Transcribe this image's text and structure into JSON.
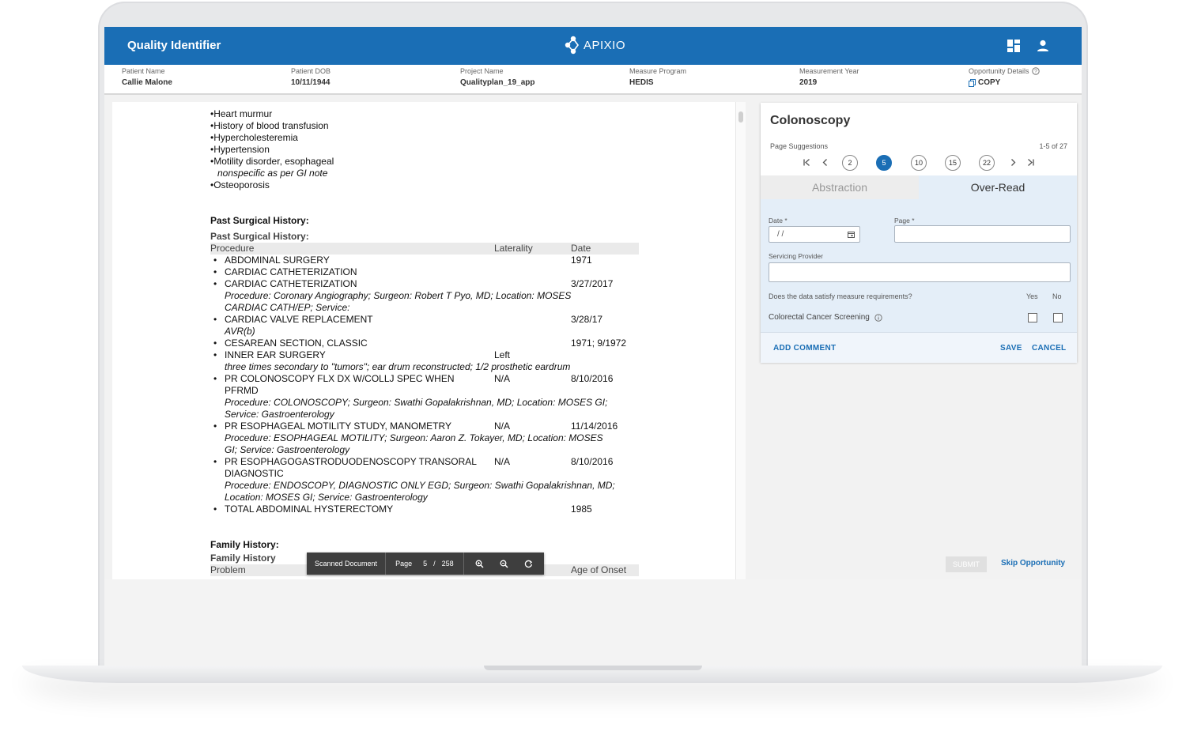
{
  "header": {
    "title": "Quality Identifier",
    "logo_text": "APIXIO"
  },
  "info": [
    {
      "label": "Patient Name",
      "value": "Callie Malone"
    },
    {
      "label": "Patient DOB",
      "value": "10/11/1944"
    },
    {
      "label": "Project Name",
      "value": "Qualityplan_19_app"
    },
    {
      "label": "Measure Program",
      "value": "HEDIS"
    },
    {
      "label": "Measurement Year",
      "value": "2019"
    },
    {
      "label": "Opportunity Details",
      "value": "COPY"
    }
  ],
  "document": {
    "conditions": [
      "Heart murmur",
      "History of blood transfusion",
      "Hypercholesteremia",
      "Hypertension",
      "Motility disorder, esophageal"
    ],
    "condition_note": "nonspecific as per GI note",
    "last_condition": "Osteoporosis",
    "surg_heading": "Past Surgical History:",
    "surg_sub": "Past Surgical History:",
    "table_headers": {
      "procedure": "Procedure",
      "laterality": "Laterality",
      "date": "Date"
    },
    "rows": [
      {
        "proc": "ABDOMINAL SURGERY",
        "lat": "",
        "date": "1971"
      },
      {
        "proc": "CARDIAC CATHETERIZATION",
        "lat": "",
        "date": ""
      },
      {
        "proc": "CARDIAC CATHETERIZATION",
        "lat": "",
        "date": "3/27/2017"
      },
      {
        "note": "Procedure: Coronary Angiography;  Surgeon: Robert T Pyo, MD;  Location: MOSES"
      },
      {
        "note": "CARDIAC CATH/EP;  Service:"
      },
      {
        "proc": "CARDIAC VALVE REPLACEMENT",
        "lat": "",
        "date": "3/28/17"
      },
      {
        "note": "AVR(b)"
      },
      {
        "proc": "CESAREAN SECTION, CLASSIC",
        "lat": "",
        "date": "1971; 9/1972"
      },
      {
        "proc": "INNER EAR SURGERY",
        "lat": "Left",
        "date": ""
      },
      {
        "note": "three times secondary to \"tumors\"; ear drum reconstructed; 1/2 prosthetic eardrum"
      },
      {
        "proc": "PR COLONOSCOPY FLX DX W/COLLJ SPEC WHEN",
        "lat": "N/A",
        "date": "8/10/2016"
      },
      {
        "cont": "PFRMD"
      },
      {
        "note": "Procedure: COLONOSCOPY;  Surgeon: Swathi Gopalakrishnan, MD;  Location: MOSES GI;"
      },
      {
        "note": "Service: Gastroenterology"
      },
      {
        "proc": "PR ESOPHAGEAL MOTILITY STUDY, MANOMETRY",
        "lat": "N/A",
        "date": "11/14/2016"
      },
      {
        "note": "Procedure: ESOPHAGEAL MOTILITY;  Surgeon: Aaron Z. Tokayer, MD;  Location: MOSES"
      },
      {
        "note": "GI;  Service: Gastroenterology"
      },
      {
        "proc": "PR ESOPHAGOGASTRODUODENOSCOPY TRANSORAL",
        "lat": "N/A",
        "date": "8/10/2016"
      },
      {
        "cont": "DIAGNOSTIC"
      },
      {
        "note": "Procedure: ENDOSCOPY, DIAGNOSTIC ONLY EGD;  Surgeon: Swathi Gopalakrishnan, MD;"
      },
      {
        "note": "Location: MOSES GI;  Service: Gastroenterology"
      },
      {
        "proc": "TOTAL ABDOMINAL HYSTERECTOMY",
        "lat": "",
        "date": "1985"
      }
    ],
    "family_heading": "Family History:",
    "family_sub": "Family History",
    "family_col_problem": "Problem",
    "family_col_onset": "Age of Onset"
  },
  "doc_toolbar": {
    "label": "Scanned Document",
    "page_label": "Page",
    "page_current": "5",
    "page_sep": "/",
    "page_total": "258"
  },
  "panel": {
    "title": "Colonoscopy",
    "suggestions_label": "Page Suggestions",
    "suggestions_count": "1-5 of 27",
    "pages": [
      "2",
      "5",
      "10",
      "15",
      "22"
    ],
    "tab_abstraction": "Abstraction",
    "tab_overread": "Over-Read",
    "date_label": "Date *",
    "date_placeholder": " /  /",
    "page_label": "Page *",
    "provider_label": "Servicing Provider",
    "question": "Does the data satisfy measure requirements?",
    "yes": "Yes",
    "no": "No",
    "measure": "Colorectal Cancer Screening",
    "add_comment": "ADD COMMENT",
    "save": "SAVE",
    "cancel": "CANCEL"
  },
  "footer": {
    "submit": "SUBMIT",
    "skip": "Skip Opportunity"
  },
  "colors": {
    "brand_blue": "#1a6eb5",
    "form_bg": "#e4eef8"
  }
}
